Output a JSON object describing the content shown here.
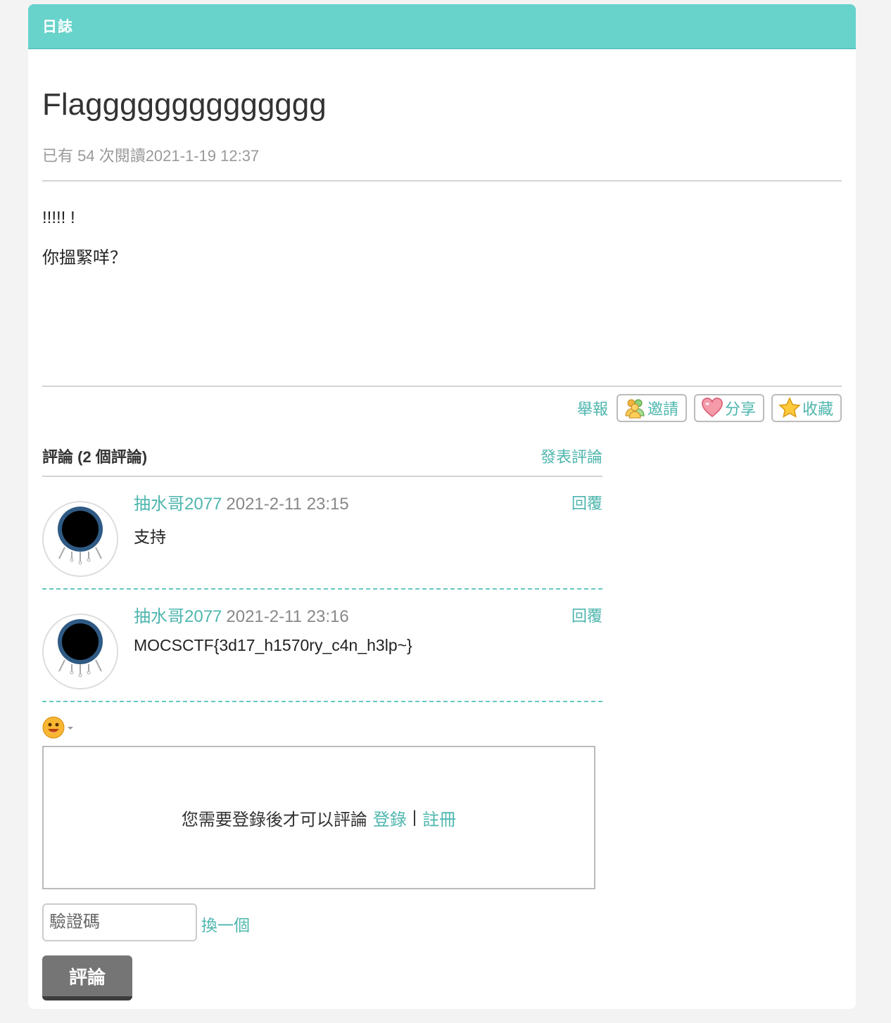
{
  "header": {
    "title": "日誌"
  },
  "post": {
    "title": "Flagggggggggggggg",
    "meta": "已有 54 次閱讀2021-1-19 12:37",
    "body": [
      "!!!!! !",
      "你搵緊咩？"
    ]
  },
  "actions": {
    "report": "舉報",
    "invite": "邀請",
    "share": "分享",
    "favorite": "收藏"
  },
  "comments": {
    "header": "評論 (2 個評論)",
    "post_link": "發表評論",
    "items": [
      {
        "author": "抽水哥2077",
        "time": "2021-2-11 23:15",
        "reply": "回覆",
        "text": "支持"
      },
      {
        "author": "抽水哥2077",
        "time": "2021-2-11 23:16",
        "reply": "回覆",
        "text": "MOCSCTF{3d17_h1570ry_c4n_h3lp~}"
      }
    ]
  },
  "form": {
    "login_prompt": "您需要登錄後才可以評論",
    "login": "登錄",
    "separator": "|",
    "register": "註冊",
    "captcha_placeholder": "驗證碼",
    "swap": "換一個",
    "submit": "評論"
  },
  "colors": {
    "accent": "#68d3cb",
    "link": "#4eb6ae"
  }
}
